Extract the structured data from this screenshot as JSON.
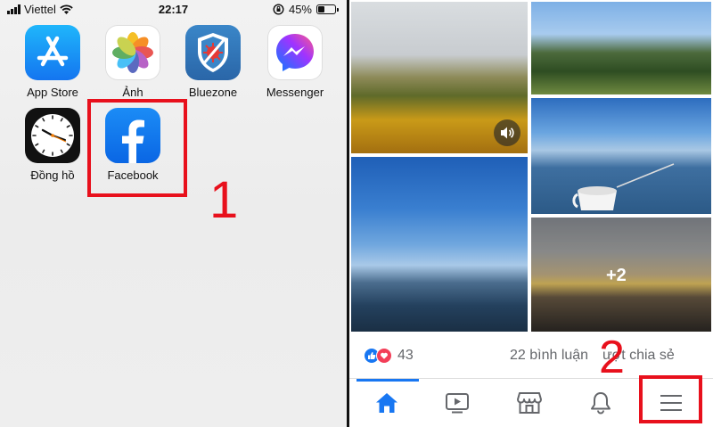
{
  "status_bar": {
    "carrier": "Viettel",
    "time": "22:17",
    "battery_percent": "45%",
    "battery_level": 0.45
  },
  "home_screen": {
    "apps": [
      {
        "label": "App Store",
        "icon": "app-store-icon"
      },
      {
        "label": "Ảnh",
        "icon": "photos-icon"
      },
      {
        "label": "Bluezone",
        "icon": "bluezone-icon"
      },
      {
        "label": "Messenger",
        "icon": "messenger-icon"
      },
      {
        "label": "Đồng hồ",
        "icon": "clock-icon"
      },
      {
        "label": "Facebook",
        "icon": "facebook-icon"
      }
    ]
  },
  "annotations": {
    "step1": "1",
    "step2": "2",
    "highlight_color": "#e8101c"
  },
  "post": {
    "more_photos": "+2",
    "reaction_count": "43",
    "comments": "22 bình luận",
    "shares": "ượt chia sẻ"
  },
  "tab_bar": {
    "tabs": [
      "home-icon",
      "watch-icon",
      "marketplace-icon",
      "notifications-icon",
      "menu-icon"
    ],
    "active": "home-icon",
    "accent": "#1877f2"
  }
}
